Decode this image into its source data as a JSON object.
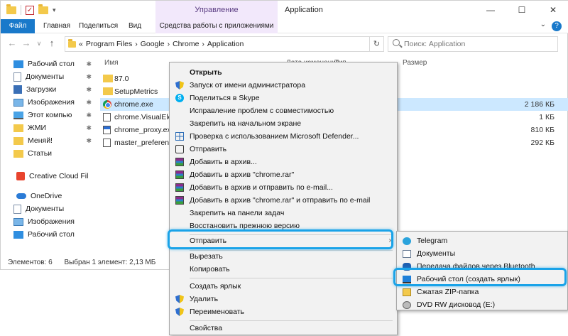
{
  "window": {
    "title": "Application",
    "contextual_group": "Управление"
  },
  "ribbon": {
    "tabs": [
      "Файл",
      "Главная",
      "Поделиться",
      "Вид"
    ],
    "tools_tab": "Средства работы с приложениями"
  },
  "address": {
    "prefix": "«",
    "crumbs": [
      "Program Files",
      "Google",
      "Chrome",
      "Application"
    ],
    "search_placeholder": "Поиск: Application"
  },
  "nav": [
    {
      "label": "Рабочий стол",
      "icon": "desktop-icon",
      "pinned": true
    },
    {
      "label": "Документы",
      "icon": "documents-icon",
      "pinned": true
    },
    {
      "label": "Загрузки",
      "icon": "downloads-icon",
      "pinned": true
    },
    {
      "label": "Изображения",
      "icon": "pictures-icon",
      "pinned": true
    },
    {
      "label": "Этот компьютер",
      "icon": "computer-icon",
      "pinned": true
    },
    {
      "label": "ЖМИ",
      "icon": "folder-icon",
      "pinned": true
    },
    {
      "label": "Меняй!",
      "icon": "folder-icon",
      "pinned": true
    },
    {
      "label": "Статьи",
      "icon": "folder-icon",
      "pinned": false
    },
    {
      "label": "Creative Cloud Fil",
      "icon": "creative-cloud-icon",
      "pinned": false
    },
    {
      "label": "OneDrive",
      "icon": "onedrive-icon",
      "pinned": false
    },
    {
      "label": "Документы",
      "icon": "documents-icon",
      "pinned": false
    },
    {
      "label": "Изображения",
      "icon": "pictures-icon",
      "pinned": false
    },
    {
      "label": "Рабочий стол",
      "icon": "desktop-icon",
      "pinned": false
    }
  ],
  "columns": {
    "name": "Имя",
    "date": "Дата изменения",
    "type": "Тип",
    "size": "Размер"
  },
  "files": [
    {
      "name": "87.0",
      "size": "",
      "icon": "folder-icon"
    },
    {
      "name": "SetupMetrics",
      "size": "",
      "icon": "folder-icon"
    },
    {
      "name": "chrome.exe",
      "size": "2 186 КБ",
      "icon": "chrome-icon"
    },
    {
      "name": "chrome.VisualElem",
      "size": "1 КБ",
      "icon": "file-icon"
    },
    {
      "name": "chrome_proxy.exe",
      "size": "810 КБ",
      "icon": "exe-icon"
    },
    {
      "name": "master_preference",
      "size": "292 КБ",
      "icon": "file-icon"
    }
  ],
  "status": {
    "count": "Элементов: 6",
    "selected": "Выбран 1 элемент: 2,13 МБ"
  },
  "context_menu": {
    "items": [
      "Открыть",
      "Запуск от имени администратора",
      "Поделиться в Skype",
      "Исправление проблем с совместимостью",
      "Закрепить на начальном экране",
      "Проверка с использованием Microsoft Defender...",
      "Отправить",
      "Добавить в архив...",
      "Добавить в архив \"chrome.rar\"",
      "Добавить в архив и отправить по e-mail...",
      "Добавить в архив \"chrome.rar\" и отправить по e-mail",
      "Закрепить на панели задач",
      "Восстановить прежнюю версию",
      "Отправить",
      "Вырезать",
      "Копировать",
      "Создать ярлык",
      "Удалить",
      "Переименовать",
      "Свойства"
    ]
  },
  "submenu": {
    "items": [
      "Telegram",
      "Документы",
      "Передача файлов через Bluetooth",
      "Рабочий стол (создать ярлык)",
      "Сжатая ZIP-папка",
      "DVD RW дисковод (E:)"
    ]
  },
  "colors": {
    "accent": "#1979ca",
    "highlight": "#1aa3e8",
    "selection": "#cce8ff",
    "manage_tab": "#f2e8fb"
  }
}
